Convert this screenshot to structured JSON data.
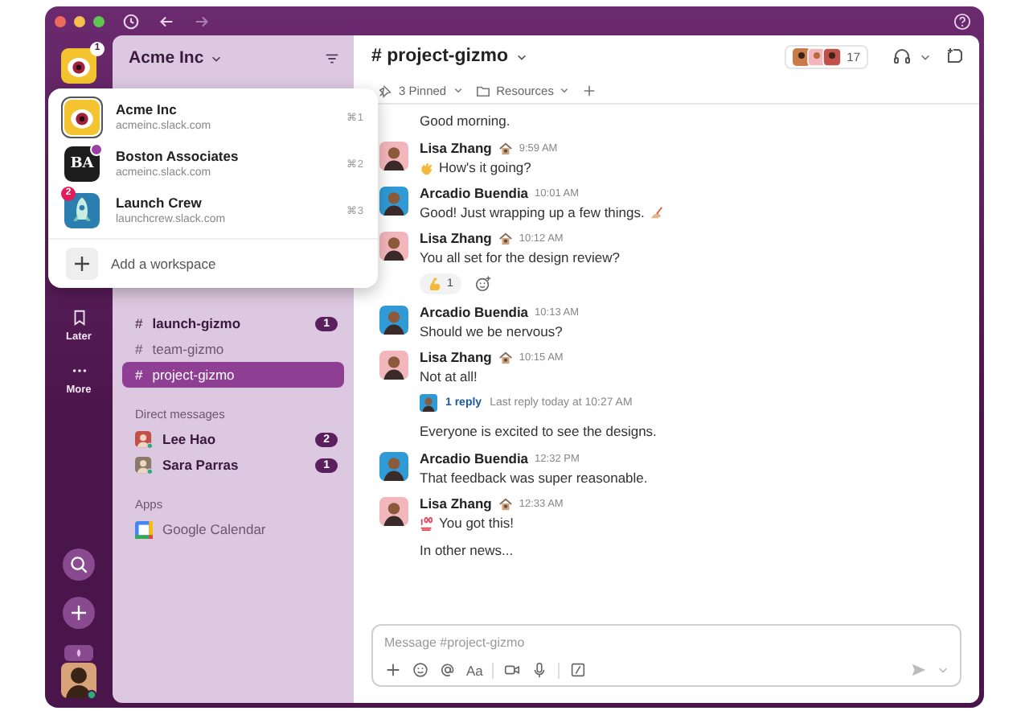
{
  "workspace": {
    "name": "Acme Inc",
    "badge": "1"
  },
  "rail": [
    {
      "label": "Later",
      "kind": "bookmark"
    },
    {
      "label": "More",
      "kind": "dots"
    }
  ],
  "workspace_menu": {
    "items": [
      {
        "name": "Acme Inc",
        "url": "acmeinc.slack.com",
        "shortcut": "⌘1",
        "selected": true,
        "kind": "eye"
      },
      {
        "name": "Boston Associates",
        "url": "acmeinc.slack.com",
        "shortcut": "⌘2",
        "selected": false,
        "kind": "letters",
        "logo_text": "BA",
        "dot": true
      },
      {
        "name": "Launch Crew",
        "url": "launchcrew.slack.com",
        "shortcut": "⌘3",
        "selected": false,
        "kind": "rocket",
        "badge": "2"
      }
    ],
    "add_label": "Add a workspace"
  },
  "sidebar": {
    "channels": [
      {
        "icon": "#",
        "name": "launch-gizmo",
        "unread": true,
        "badge": "1",
        "selected": false
      },
      {
        "icon": "#",
        "name": "team-gizmo",
        "unread": false,
        "selected": false
      },
      {
        "icon": "#",
        "name": "project-gizmo",
        "unread": false,
        "selected": true
      }
    ],
    "dm_heading": "Direct messages",
    "dms": [
      {
        "name": "Lee Hao",
        "badge": "2",
        "color": "#c0504a"
      },
      {
        "name": "Sara Parras",
        "badge": "1",
        "color": "#8a7a6a"
      }
    ],
    "apps_heading": "Apps",
    "apps": [
      {
        "name": "Google Calendar"
      }
    ]
  },
  "channel": {
    "name": "# project-gizmo",
    "member_count": "17",
    "pinned": "3 Pinned",
    "resources": "Resources"
  },
  "messages": [
    {
      "kind": "continuation",
      "text": "Good morning."
    },
    {
      "kind": "message",
      "author": "Lisa Zhang",
      "status_icon": true,
      "time": "9:59 AM",
      "avatar": {
        "color": "#f3b6bd"
      },
      "lead_icon": {
        "kind": "wave"
      },
      "text": "How's it going?"
    },
    {
      "kind": "message",
      "author": "Arcadio Buendia",
      "status_icon": false,
      "time": "10:01 AM",
      "avatar": {
        "color": "#2f9ad6"
      },
      "text": "Good! Just wrapping up a few things.",
      "trail_icon": {
        "kind": "writing"
      }
    },
    {
      "kind": "message",
      "author": "Lisa Zhang",
      "status_icon": true,
      "time": "10:12 AM",
      "avatar": {
        "color": "#f3b6bd"
      },
      "text": "You all set for the design review?",
      "reactions": [
        {
          "count": "1"
        }
      ]
    },
    {
      "kind": "message",
      "author": "Arcadio Buendia",
      "status_icon": false,
      "time": "10:13 AM",
      "avatar": {
        "color": "#2f9ad6"
      },
      "text": "Should we be nervous?"
    },
    {
      "kind": "message",
      "author": "Lisa Zhang",
      "status_icon": true,
      "time": "10:15 AM",
      "avatar": {
        "color": "#f3b6bd"
      },
      "text": "Not at all!",
      "thread": {
        "replies": "1 reply",
        "last": "Last reply today at 10:27 AM"
      }
    },
    {
      "kind": "continuation",
      "text": "Everyone is excited to see the designs."
    },
    {
      "kind": "message",
      "author": "Arcadio Buendia",
      "status_icon": false,
      "time": "12:32 PM",
      "avatar": {
        "color": "#2f9ad6"
      },
      "text": "That feedback was super reasonable."
    },
    {
      "kind": "message",
      "author": "Lisa Zhang",
      "status_icon": true,
      "time": "12:33 AM",
      "avatar": {
        "color": "#f3b6bd"
      },
      "lead_icon": {
        "kind": "hundred"
      },
      "text": "You got this!"
    },
    {
      "kind": "continuation",
      "text": "In other news..."
    }
  ],
  "composer": {
    "placeholder": "Message #project-gizmo",
    "format_label": "Aa"
  }
}
